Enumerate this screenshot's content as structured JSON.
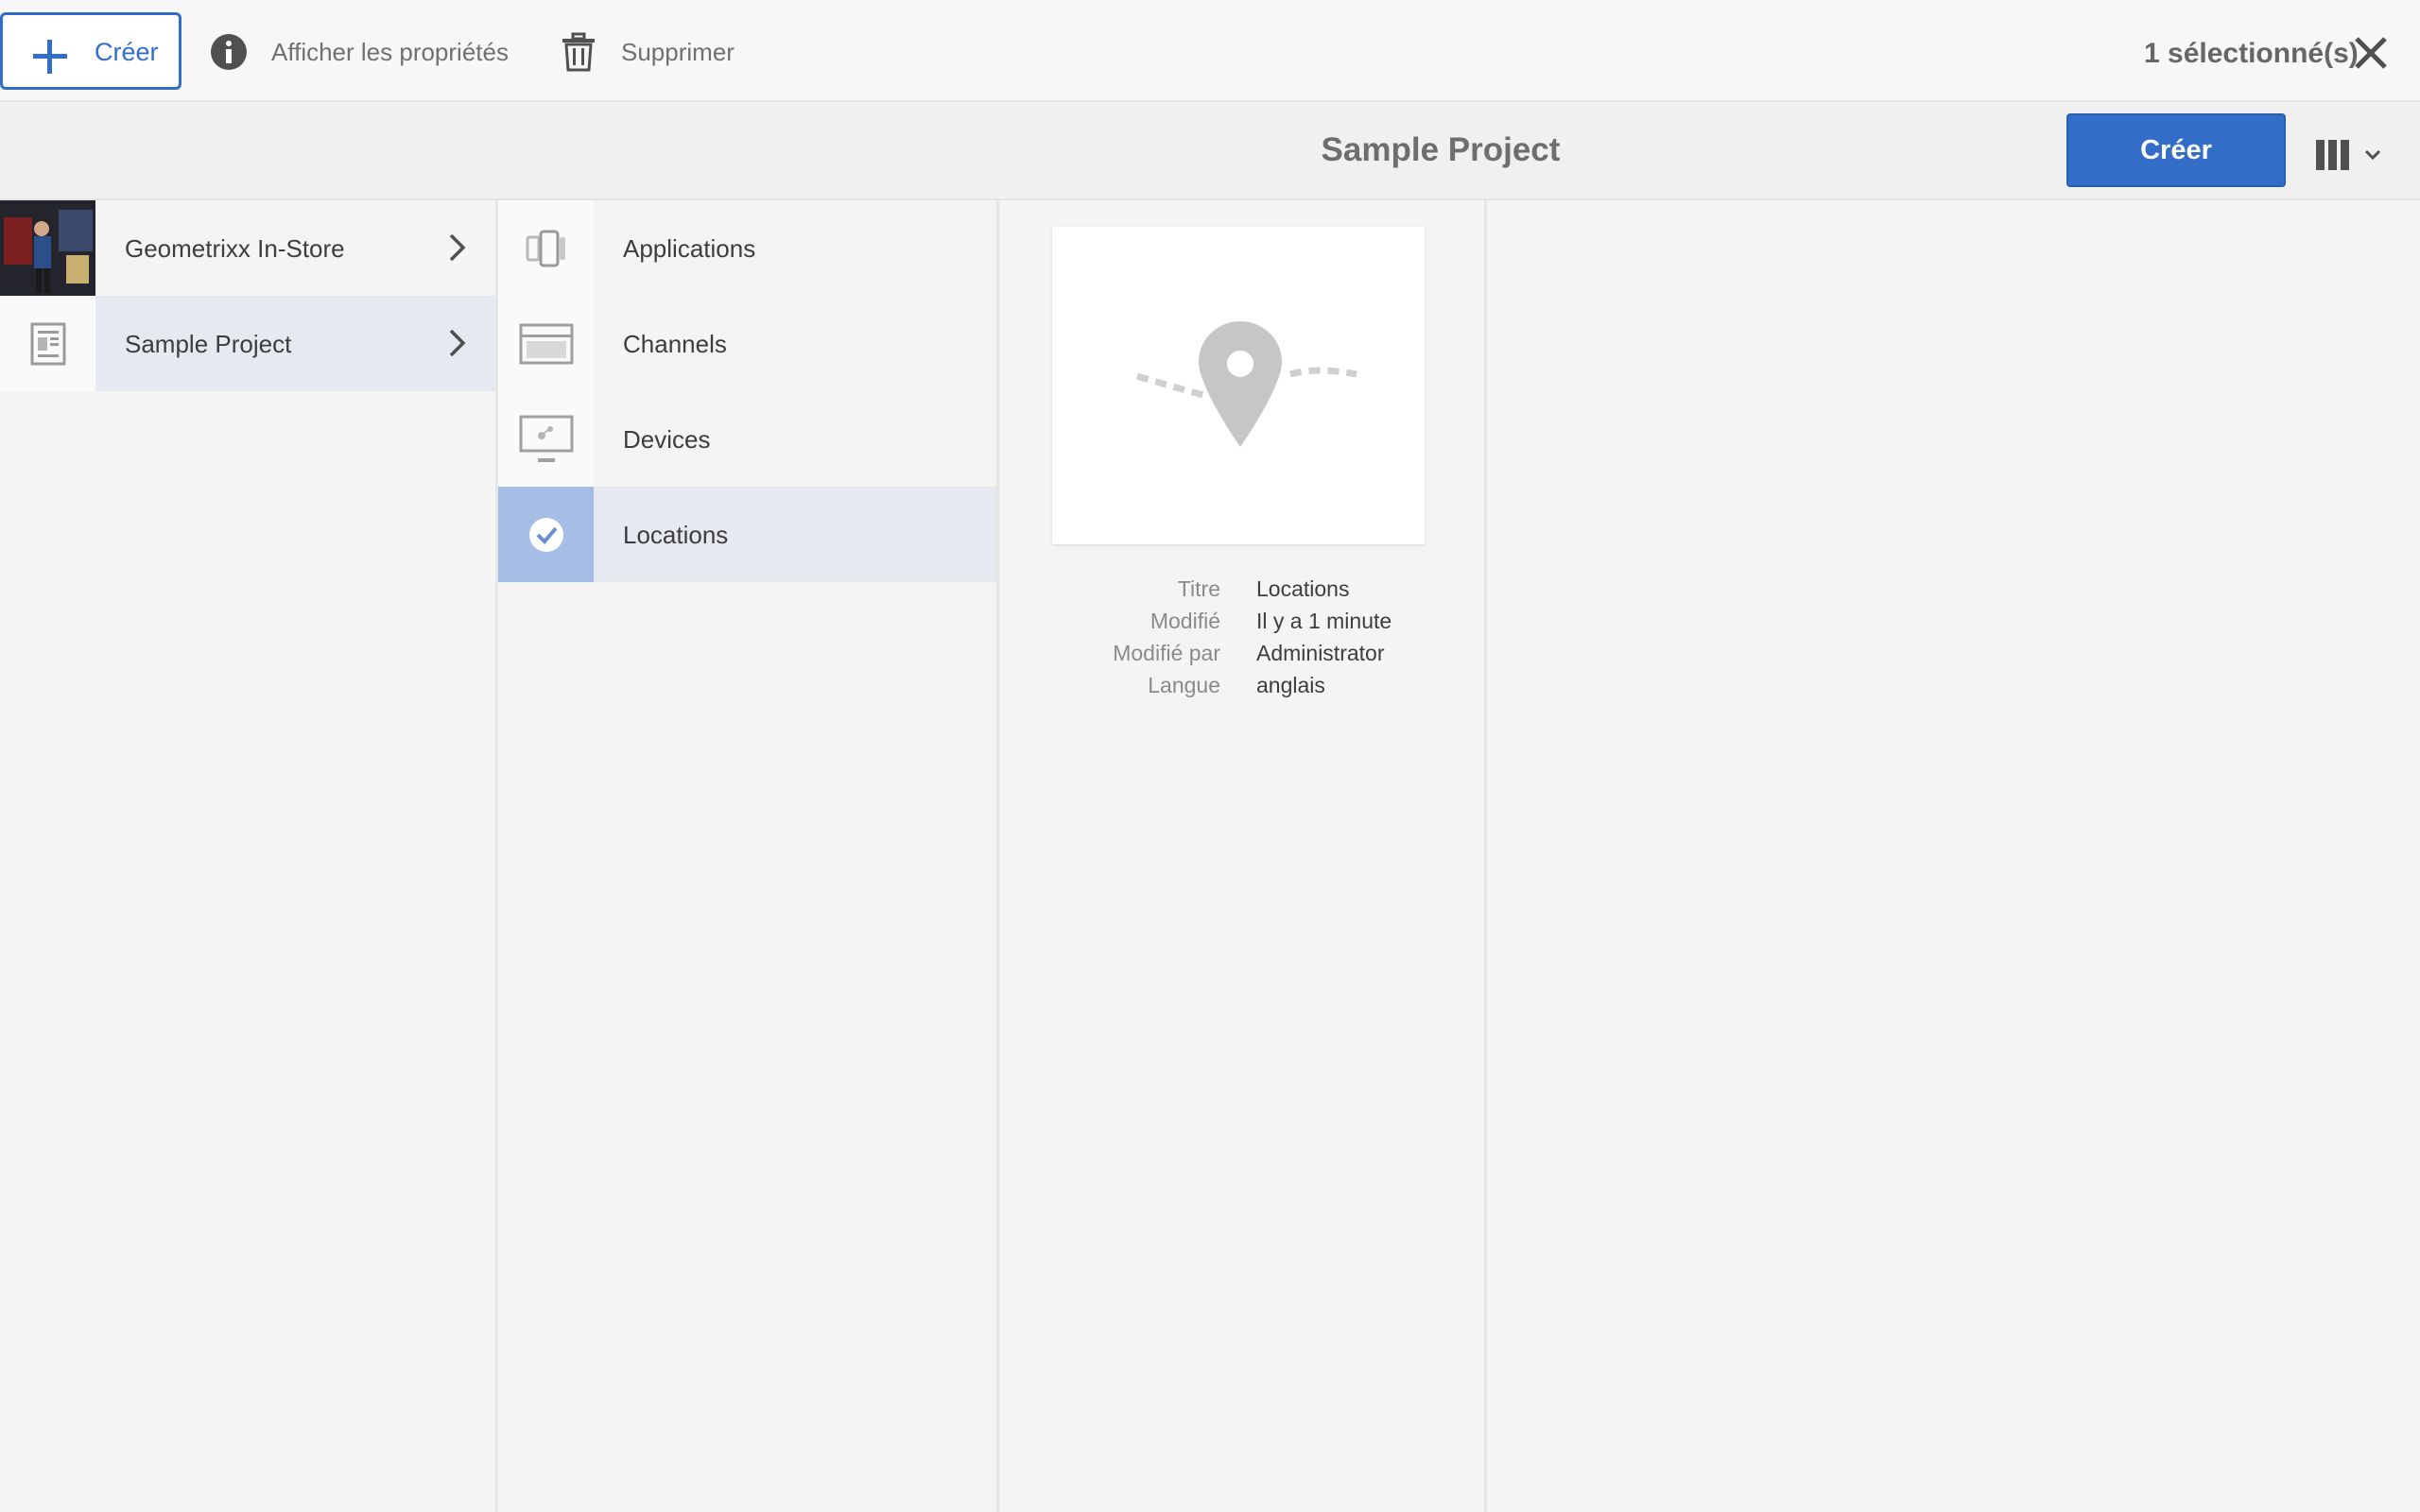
{
  "actionbar": {
    "create_label": "Créer",
    "properties_label": "Afficher les propriétés",
    "delete_label": "Supprimer",
    "selection_count": "1 sélectionné(s)"
  },
  "titlebar": {
    "title": "Sample Project",
    "create_label": "Créer"
  },
  "columns": {
    "projects": [
      {
        "label": "Geometrixx In-Store",
        "icon": "store-photo-thumbnail"
      },
      {
        "label": "Sample Project",
        "icon": "project-icon"
      }
    ],
    "folders": [
      {
        "label": "Applications",
        "icon": "applications-icon"
      },
      {
        "label": "Channels",
        "icon": "channels-icon"
      },
      {
        "label": "Devices",
        "icon": "devices-icon"
      },
      {
        "label": "Locations",
        "icon": "checkmark-icon"
      }
    ]
  },
  "details": {
    "labels": {
      "title": "Titre",
      "modified": "Modifié",
      "modified_by": "Modifié par",
      "language": "Langue"
    },
    "values": {
      "title": "Locations",
      "modified": "Il y a 1 minute",
      "modified_by": "Administrator",
      "language": "anglais"
    }
  },
  "colors": {
    "accent": "#326ec8",
    "selected_row": "#e6e9ef",
    "checked_thumb": "#a6bde6"
  }
}
